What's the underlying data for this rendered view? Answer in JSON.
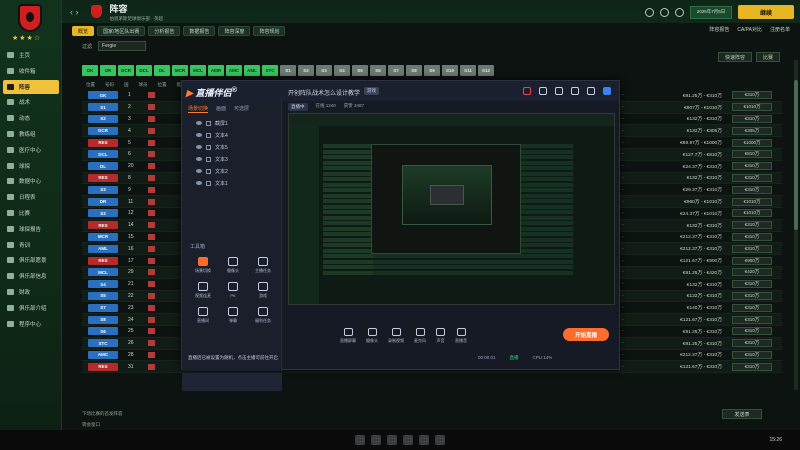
{
  "sidebar": {
    "items": [
      {
        "label": "主页",
        "icon": "home-icon"
      },
      {
        "label": "收件箱",
        "icon": "inbox-icon"
      },
      {
        "label": "阵容",
        "icon": "squad-icon",
        "active": true
      },
      {
        "label": "战术",
        "icon": "tactics-icon"
      },
      {
        "label": "动态",
        "icon": "dynamics-icon"
      },
      {
        "label": "教练组",
        "icon": "staff-icon"
      },
      {
        "label": "医疗中心",
        "icon": "medical-icon"
      },
      {
        "label": "球探",
        "icon": "scouting-icon"
      },
      {
        "label": "数据中心",
        "icon": "data-icon"
      },
      {
        "label": "日程表",
        "icon": "schedule-icon"
      },
      {
        "label": "比赛",
        "icon": "competition-icon"
      },
      {
        "label": "球探报告",
        "icon": "report-icon"
      },
      {
        "label": "青训",
        "icon": "youth-icon"
      },
      {
        "label": "俱乐部愿景",
        "icon": "vision-icon"
      },
      {
        "label": "俱乐部信息",
        "icon": "club-info-icon"
      },
      {
        "label": "财政",
        "icon": "finance-icon"
      },
      {
        "label": "俱乐部介绍",
        "icon": "club-intro-icon"
      },
      {
        "label": "程序中心",
        "icon": "dev-centre-icon"
      }
    ]
  },
  "topbar": {
    "title": "阵容",
    "subtitle": "伯恩茅斯足球俱乐部 · 英超",
    "date": "2025年7月5日",
    "continue_label": "继续"
  },
  "subtabs": [
    "概览",
    "国家/地区队出赛",
    "分析报告",
    "数据报告",
    "阵容深度",
    "阵容规划"
  ],
  "subtabs_right": [
    "阵容报告",
    "CA/PA对比",
    "注册名单"
  ],
  "filters": {
    "select": "Fergie",
    "label": "过滤"
  },
  "right_controls": [
    "快速阵容",
    "比赛"
  ],
  "chips": [
    "GK",
    "DR",
    "DCR",
    "DCL",
    "DL",
    "MCR",
    "MCL",
    "AMR",
    "AMC",
    "AML",
    "STC",
    "S1",
    "S2",
    "S3",
    "S4",
    "S5",
    "S6",
    "S7",
    "S8",
    "S9",
    "S10",
    "S11",
    "S12"
  ],
  "chip_green_count": 11,
  "table_head": [
    "位置",
    "号码",
    "国",
    "球员",
    "位置",
    "能力",
    "潜力",
    "身价",
    "合同"
  ],
  "rows": [
    {
      "pos": "GK",
      "num": "1",
      "value": "€91.25万 - €310万",
      "btn": "€310万",
      "c": "blue"
    },
    {
      "pos": "S1",
      "num": "2",
      "value": "€907万 - €1010万",
      "btn": "€1010万",
      "c": "blue"
    },
    {
      "pos": "S2",
      "num": "3",
      "value": "€132万 - €310万",
      "btn": "€310万",
      "c": "blue"
    },
    {
      "pos": "DCR",
      "num": "4",
      "value": "€132万 - €305万",
      "btn": "€305万",
      "c": "blue"
    },
    {
      "pos": "RES",
      "num": "5",
      "value": "€69.97万 - €1000万",
      "btn": "€1000万",
      "c": "red"
    },
    {
      "pos": "DCL",
      "num": "6",
      "value": "€127.7万 - €810万",
      "btn": "€810万",
      "c": "blue"
    },
    {
      "pos": "DL",
      "num": "20",
      "value": "€24.37万 - €310万",
      "btn": "€310万",
      "c": "blue"
    },
    {
      "pos": "RES",
      "num": "8",
      "value": "€132万 - €310万",
      "btn": "€310万",
      "c": "red"
    },
    {
      "pos": "S3",
      "num": "9",
      "value": "€29.37万 - €310万",
      "btn": "€310万",
      "c": "blue"
    },
    {
      "pos": "DR",
      "num": "11",
      "value": "€960万 - €1010万",
      "btn": "€1010万",
      "c": "blue"
    },
    {
      "pos": "S3",
      "num": "12",
      "value": "€24.37万 - €1010万",
      "btn": "€1010万",
      "c": "blue"
    },
    {
      "pos": "RES",
      "num": "14",
      "value": "€132万 - €310万",
      "btn": "€310万",
      "c": "red"
    },
    {
      "pos": "MCR",
      "num": "15",
      "value": "€212.37万 - €310万",
      "btn": "€310万",
      "c": "blue"
    },
    {
      "pos": "AML",
      "num": "16",
      "value": "€212.37万 - €310万",
      "btn": "€310万",
      "c": "blue"
    },
    {
      "pos": "RES",
      "num": "17",
      "value": "€121.67万 - €900万",
      "btn": "€900万",
      "c": "red"
    },
    {
      "pos": "MCL",
      "num": "29",
      "value": "€91.25万 - €420万",
      "btn": "€420万",
      "c": "blue"
    },
    {
      "pos": "S4",
      "num": "21",
      "value": "€132万 - €310万",
      "btn": "€310万",
      "c": "blue"
    },
    {
      "pos": "S5",
      "num": "22",
      "value": "€132万 - €310万",
      "btn": "€310万",
      "c": "blue"
    },
    {
      "pos": "S7",
      "num": "23",
      "value": "€140万 - €310万",
      "btn": "€310万",
      "c": "blue"
    },
    {
      "pos": "S8",
      "num": "24",
      "value": "€121.67万 - €310万",
      "btn": "€310万",
      "c": "blue"
    },
    {
      "pos": "S6",
      "num": "25",
      "value": "€91.25万 - €310万",
      "btn": "€310万",
      "c": "blue"
    },
    {
      "pos": "STC",
      "num": "26",
      "value": "€91.25万 - €310万",
      "btn": "€310万",
      "c": "blue"
    },
    {
      "pos": "AMC",
      "num": "28",
      "value": "€212.37万 - €310万",
      "btn": "€310万",
      "c": "blue"
    },
    {
      "pos": "RES",
      "num": "31",
      "value": "€121.67万 - €310万",
      "btn": "€310万",
      "c": "red"
    }
  ],
  "extra_rows": [
    {
      "row": 21,
      "name": "西马尔·奥",
      "pos": "AM (RL), ST (C)",
      "stars": "★★★★",
      "club": "埃迪斯",
      "skill": "迅捷",
      "pct": "80%"
    },
    {
      "row": 22,
      "name": "多米尼克·索兰克",
      "pos": "ST (C)",
      "stars": "★★★★",
      "club": "莫雷诺",
      "skill": "好",
      "pct": "81%"
    },
    {
      "row": 23,
      "name": "露希·泰尔",
      "pos": "ST (C)",
      "stars": "★★★",
      "club": "鲍尔",
      "skill": "极好",
      "pct": "83%"
    }
  ],
  "bottom": {
    "text": "下场比赛的首发阵容",
    "status": "转会窗口",
    "button": "发送表"
  },
  "taskbar_clock": "15:26",
  "overlay": {
    "logo_main": "直播伴侣",
    "logo_suffix": "®",
    "title": "开创阵队战术怎么设计教学",
    "tag": "游戏",
    "info": [
      "直播中",
      "在线 1240",
      "获赞 3487"
    ],
    "tabs": [
      "场景切换",
      "画面",
      "可选层"
    ],
    "layers": [
      "截屏1",
      "文本4",
      "文本5",
      "文本3",
      "文本2",
      "文本1"
    ],
    "tools_title": "工具箱",
    "tools": [
      "场景切换",
      "摄像头",
      "主播任务",
      "视频连麦",
      "PK",
      "游戏",
      "直播间",
      "弹幕",
      "福利任务"
    ],
    "controls": [
      "直播屏幕",
      "摄像头",
      "录制视频",
      "麦克风",
      "声音",
      "直播音"
    ],
    "start_live": "开始直播",
    "notice": "直播后已被设置为随机，点击主播可前往开启",
    "status": [
      "00:00:01",
      "直播",
      "CPU 14%"
    ]
  }
}
